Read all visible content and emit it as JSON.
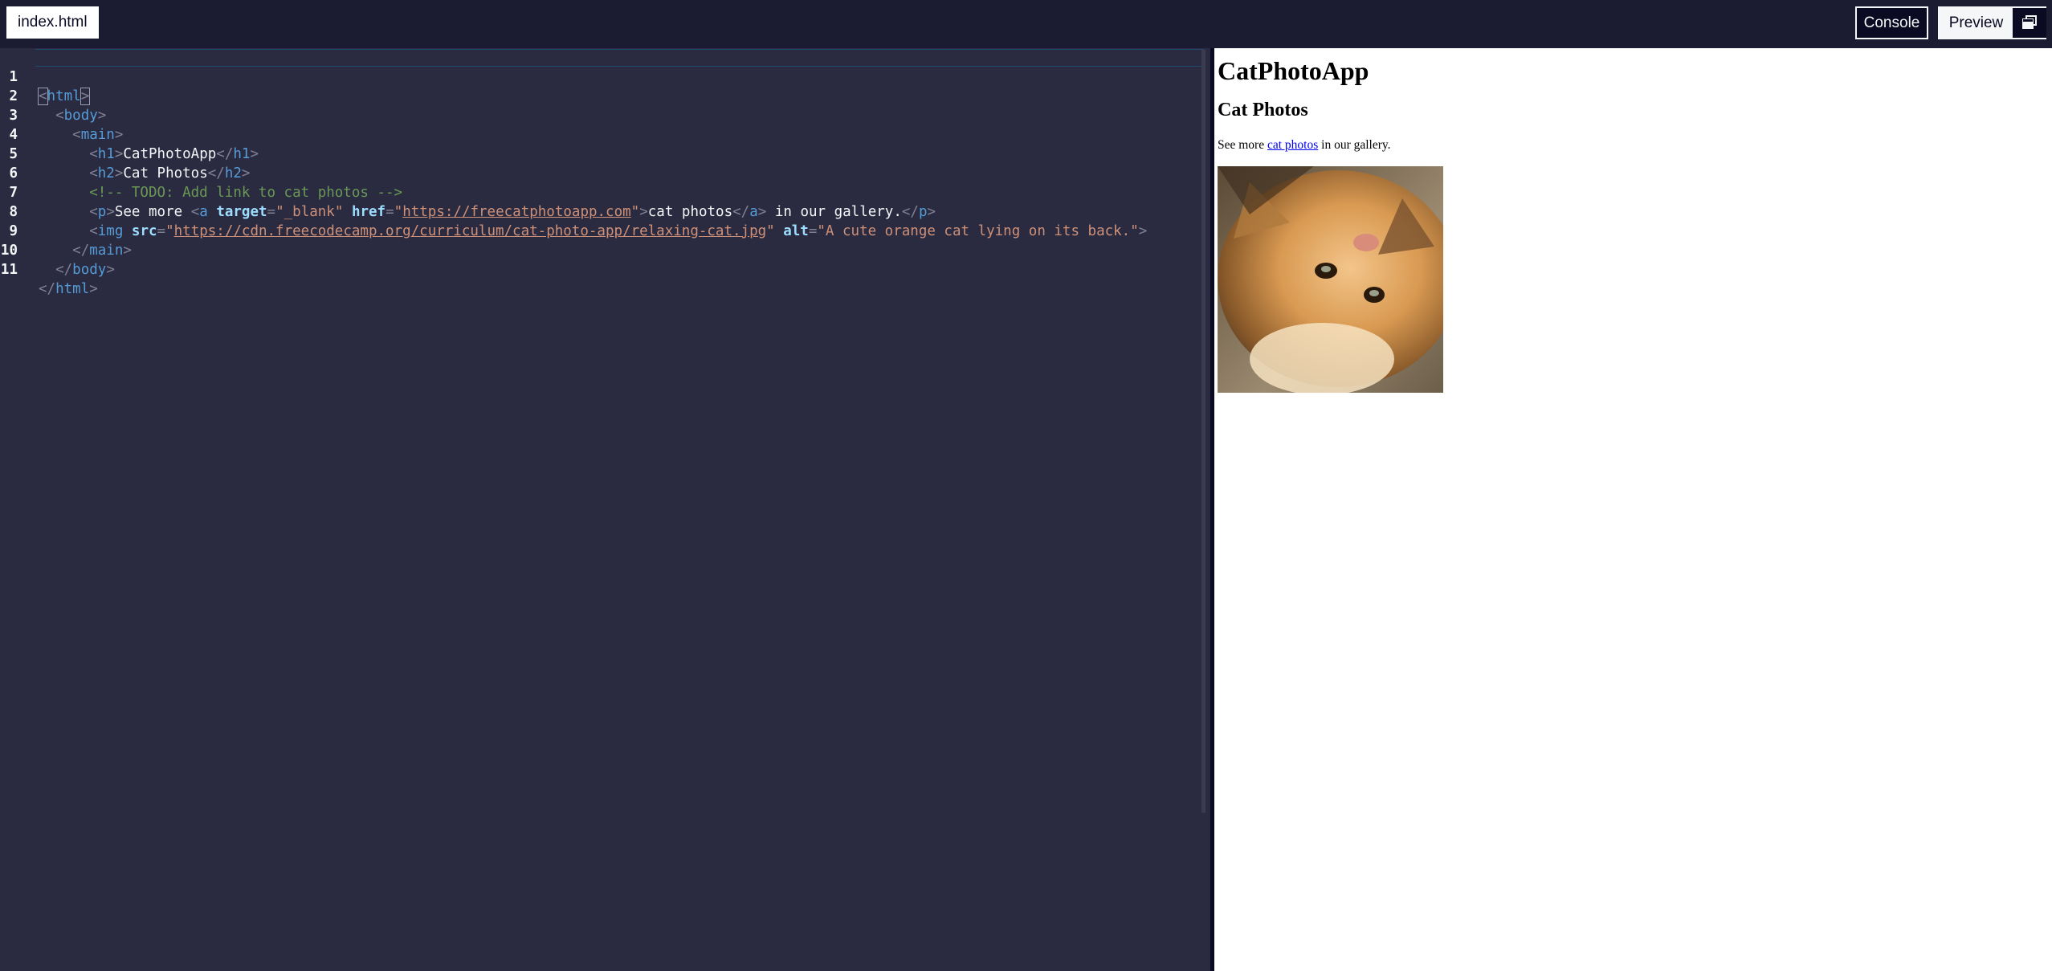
{
  "file_tab": "index.html",
  "buttons": {
    "console": "Console",
    "preview": "Preview"
  },
  "icons": {
    "popout": "window-popout-icon"
  },
  "editor": {
    "line_numbers": [
      "1",
      "2",
      "3",
      "4",
      "5",
      "6",
      "7",
      "8",
      "9",
      "10",
      "11"
    ],
    "code": {
      "l1_open": "<",
      "l1_tag": "html",
      "l1_close": ">",
      "l2_open": "<",
      "l2_tag": "body",
      "l2_close": ">",
      "l3_open": "<",
      "l3_tag": "main",
      "l3_close": ">",
      "l4_open": "<",
      "l4_tag": "h1",
      "l4_close": ">",
      "l4_text": "CatPhotoApp",
      "l4_endopen": "</",
      "l4_endtag": "h1",
      "l4_endclose": ">",
      "l5_open": "<",
      "l5_tag": "h2",
      "l5_close": ">",
      "l5_text": "Cat Photos",
      "l5_endopen": "</",
      "l5_endtag": "h2",
      "l5_endclose": ">",
      "l6_comment": "<!-- TODO: Add link to cat photos -->",
      "l7_p_open": "<",
      "l7_p_tag": "p",
      "l7_p_close": ">",
      "l7_text1": "See more ",
      "l7_a_open": "<",
      "l7_a_tag": "a",
      "l7_attr1": "target",
      "l7_eq1": "=",
      "l7_val1": "\"_blank\"",
      "l7_attr2": "href",
      "l7_eq2": "=",
      "l7_q1": "\"",
      "l7_url": "https://freecatphotoapp.com",
      "l7_q2": "\"",
      "l7_a_close": ">",
      "l7_text2": "cat photos",
      "l7_a_endopen": "</",
      "l7_a_endtag": "a",
      "l7_a_endclose": ">",
      "l7_text3": " in our gallery.",
      "l7_p_endopen": "</",
      "l7_p_endtag": "p",
      "l7_p_endclose": ">",
      "l8_open": "<",
      "l8_tag": "img",
      "l8_attr1": "src",
      "l8_eq1": "=",
      "l8_q1": "\"",
      "l8_url": "https://cdn.freecodecamp.org/curriculum/cat-photo-app/relaxing-cat.jpg",
      "l8_q2": "\"",
      "l8_attr2": "alt",
      "l8_eq2": "=",
      "l8_val2": "\"A cute orange cat lying on its back.\"",
      "l8_close": ">",
      "l9_open": "</",
      "l9_tag": "main",
      "l9_close": ">",
      "l10_open": "</",
      "l10_tag": "body",
      "l10_close": ">",
      "l11_open": "</",
      "l11_tag": "html",
      "l11_close": ">"
    }
  },
  "preview": {
    "h1": "CatPhotoApp",
    "h2": "Cat Photos",
    "p_before": "See more ",
    "p_link": "cat photos",
    "p_after": " in our gallery."
  }
}
